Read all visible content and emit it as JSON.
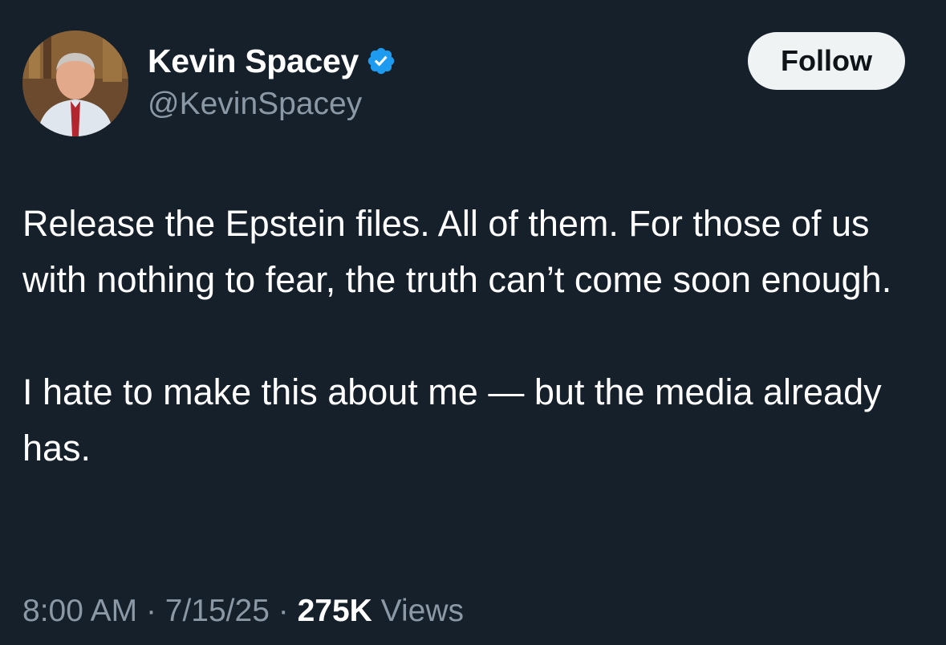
{
  "author": {
    "display_name": "Kevin Spacey",
    "handle": "@KevinSpacey",
    "verified": true,
    "avatar_icon": "profile-photo"
  },
  "follow_button": {
    "label": "Follow"
  },
  "tweet": {
    "paragraphs": [
      "Release the Epstein files. All of them. For those of us with nothing to fear, the truth can’t come soon enough.",
      "I hate to make this about me — but the media already has."
    ]
  },
  "meta": {
    "time": "8:00 AM",
    "separator": "·",
    "date": "7/15/25",
    "views_count": "275K",
    "views_label": "Views"
  },
  "colors": {
    "background": "#16202a",
    "text_primary": "#ffffff",
    "text_secondary": "#8b98a5",
    "verified_badge": "#1d9bf0",
    "follow_button_bg": "#eff3f4"
  }
}
